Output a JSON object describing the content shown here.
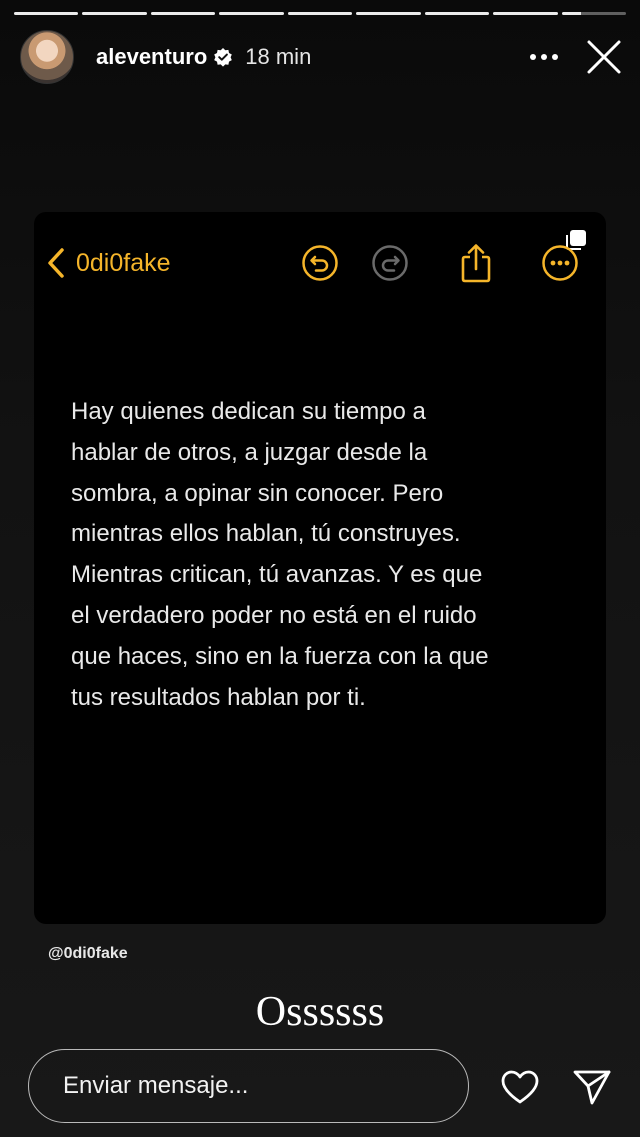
{
  "story": {
    "progress": {
      "total_segments": 9,
      "completed_segments": 8,
      "current_fraction": 0.3
    },
    "author": {
      "username": "aleventuro",
      "verified": true,
      "time_ago": "18 min"
    },
    "icons": {
      "more": "more-horizontal-icon",
      "close": "close-icon",
      "like": "heart-icon",
      "send": "send-icon"
    }
  },
  "notes_screenshot": {
    "back_label": "0di0fake",
    "accent_color": "#f5b52a",
    "toolbar_icons": [
      "undo-icon",
      "redo-icon",
      "share-icon",
      "more-circle-icon"
    ],
    "body_lines": [
      "Hay quienes dedican su tiempo a",
      "hablar de otros, a juzgar desde la",
      "sombra, a opinar sin conocer. Pero",
      "mientras ellos hablan, tú construyes.",
      "Mientras critican, tú avanzas. Y es que",
      "el verdadero poder no está en el ruido",
      "que haces, sino en la fuerza con la que",
      "tus resultados hablan por ti."
    ]
  },
  "source_tag": "@0di0fake",
  "caption": "Ossssss",
  "reply": {
    "placeholder": "Enviar mensaje..."
  }
}
